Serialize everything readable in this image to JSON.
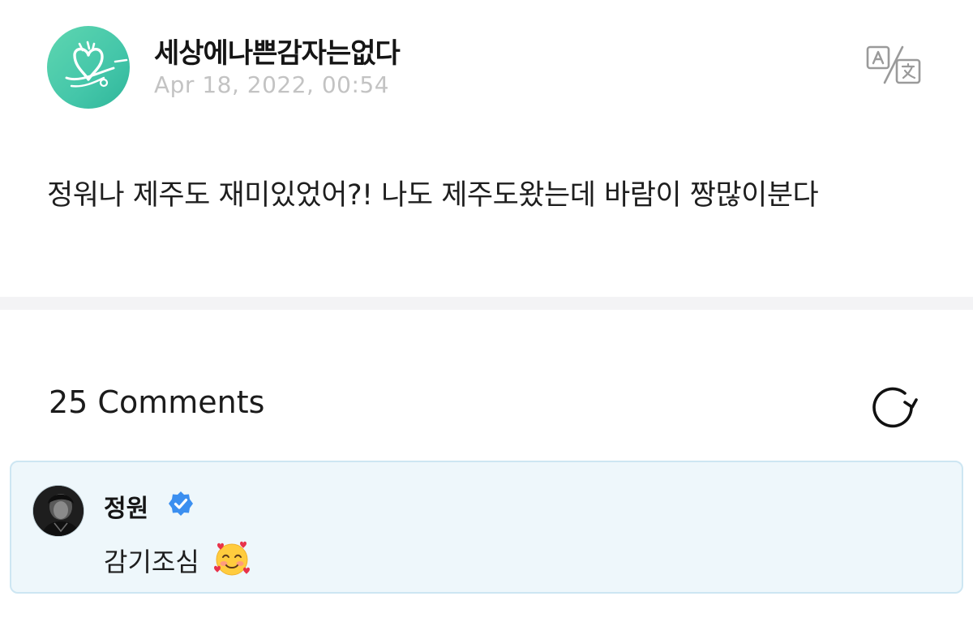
{
  "post": {
    "author": "세상에나쁜감자는없다",
    "timestamp": "Apr 18, 2022, 00:54",
    "body": "정워나 제주도 재미있었어?! 나도 제주도왔는데 바람이 짱많이분다",
    "translate_icon": "translate-icon",
    "avatar_colors": [
      "#5ed6b0",
      "#2fb69a"
    ]
  },
  "comments": {
    "count_label": "25 Comments",
    "refresh_icon": "refresh-icon",
    "items": [
      {
        "author": "정원",
        "verified": true,
        "verified_color": "#3b8ff0",
        "text": "감기조심",
        "emoji": "smiling-face-with-hearts"
      }
    ]
  },
  "colors": {
    "card_bg": "#eef7fb",
    "card_border": "#cde6f2",
    "divider": "#f3f3f5",
    "muted_text": "#c3c3c3"
  }
}
